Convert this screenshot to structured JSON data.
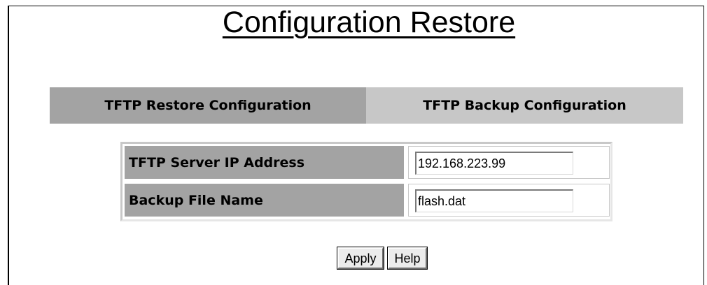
{
  "page": {
    "title": "Configuration Restore"
  },
  "tabs": [
    {
      "label": "TFTP Restore Configuration",
      "active": true
    },
    {
      "label": "TFTP Backup Configuration",
      "active": false
    }
  ],
  "form": {
    "fields": [
      {
        "label": "TFTP Server IP Address",
        "value": "192.168.223.99"
      },
      {
        "label": "Backup File Name",
        "value": "flash.dat"
      }
    ]
  },
  "buttons": {
    "apply_label": "Apply",
    "help_label": "Help"
  },
  "colors": {
    "active_tab": "#a3a3a3",
    "inactive_tab": "#c7c7c7",
    "label_cell": "#a3a3a3"
  }
}
